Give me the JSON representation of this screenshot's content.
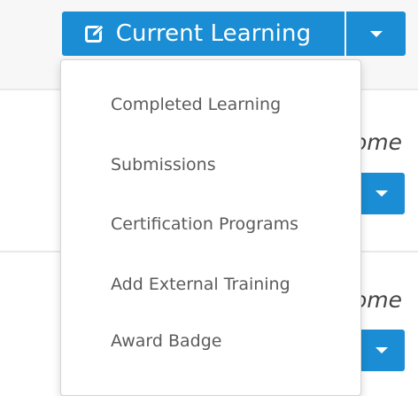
{
  "header": {
    "button_label": "Current Learning",
    "button_icon": "edit-icon",
    "accent_color": "#1a8dd4"
  },
  "background_rows": [
    {
      "partial_text": "ome"
    },
    {
      "partial_text": "ome"
    }
  ],
  "dropdown": {
    "items": [
      {
        "label": "Completed Learning"
      },
      {
        "label": "Submissions"
      },
      {
        "label": "Certification Programs"
      },
      {
        "label": "Add External Training"
      },
      {
        "label": "Award Badge"
      }
    ]
  }
}
